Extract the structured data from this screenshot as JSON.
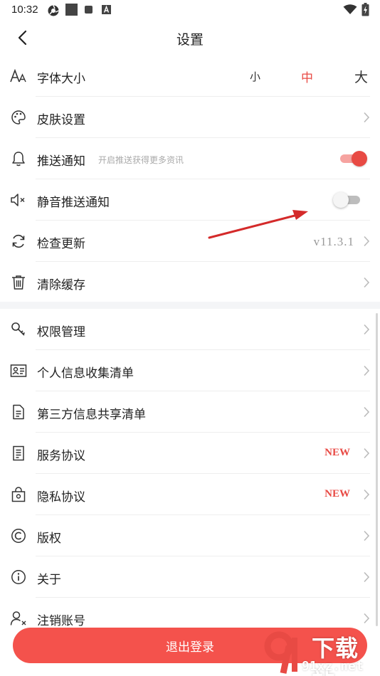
{
  "status_bar": {
    "time": "10:32"
  },
  "header": {
    "title": "设置"
  },
  "font_size": {
    "label": "字体大小",
    "options": [
      "小",
      "中",
      "大"
    ],
    "selected_index": 1
  },
  "rows": {
    "skin": {
      "label": "皮肤设置"
    },
    "push": {
      "label": "推送通知",
      "hint": "开启推送获得更多资讯",
      "enabled": true
    },
    "silent_push": {
      "label": "静音推送通知",
      "enabled": false
    },
    "update": {
      "label": "检查更新",
      "version": "v11.3.1"
    },
    "cache": {
      "label": "清除缓存"
    },
    "permissions": {
      "label": "权限管理"
    },
    "personal_info": {
      "label": "个人信息收集清单"
    },
    "third_party": {
      "label": "第三方信息共享清单"
    },
    "service": {
      "label": "服务协议",
      "badge": "NEW"
    },
    "privacy": {
      "label": "隐私协议",
      "badge": "NEW"
    },
    "copyright": {
      "label": "版权"
    },
    "about": {
      "label": "关于"
    },
    "cancel_account": {
      "label": "注销账号"
    }
  },
  "logout": {
    "label": "退出登录"
  },
  "watermark": {
    "top": "下载站",
    "bottom": "91xz.net"
  },
  "colors": {
    "accent": "#e84a44",
    "logout_bg": "#f4524c",
    "annotation_arrow": "#d42a2a"
  },
  "icons": {
    "font_size": "font-size-icon",
    "skin": "palette-icon",
    "push": "bell-icon",
    "silent_push": "speaker-mute-icon",
    "update": "refresh-icon",
    "cache": "trash-icon",
    "permissions": "key-icon",
    "personal_info": "id-card-icon",
    "third_party": "document-icon",
    "service": "document-lines-icon",
    "privacy": "lock-bag-icon",
    "copyright": "copyright-icon",
    "about": "info-icon",
    "cancel_account": "user-remove-icon"
  }
}
